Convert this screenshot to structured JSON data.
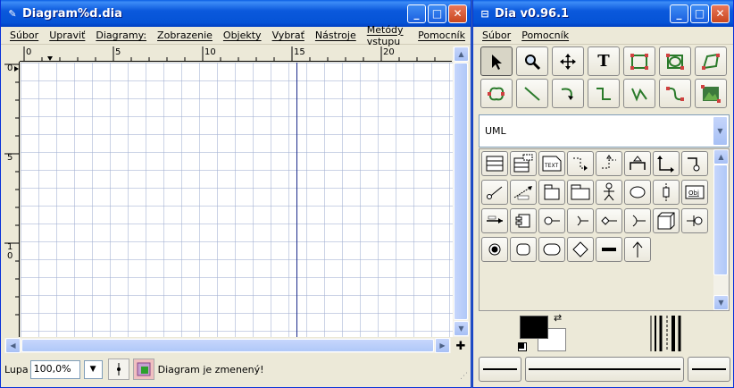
{
  "main_window": {
    "title": "Diagram%d.dia",
    "menu": [
      "Súbor",
      "Upraviť",
      "Diagramy:",
      "Zobrazenie",
      "Objekty",
      "Vybrať",
      "Nástroje",
      "Metódy vstupu",
      "Pomocník"
    ],
    "ruler_h": [
      "0",
      "5",
      "10",
      "15",
      "20"
    ],
    "ruler_v": [
      "0",
      "5",
      "1",
      "0"
    ],
    "zoom_label": "Lupa",
    "zoom_value": "100,0%",
    "status": "Diagram je zmenený!"
  },
  "toolbox": {
    "title": "Dia v0.96.1",
    "menu": [
      "Súbor",
      "Pomocník"
    ],
    "sheet": "UML",
    "tools": [
      "modify-tool",
      "zoom-tool",
      "scroll-tool",
      "text-tool",
      "box-tool",
      "ellipse-tool",
      "polygon-tool",
      "beziergon-tool",
      "line-tool",
      "arc-tool",
      "zigzagline-tool",
      "polyline-tool",
      "bezierline-tool",
      "image-tool"
    ],
    "uml_shapes": [
      "class",
      "template-class",
      "note",
      "dependency",
      "realization",
      "generalization",
      "association",
      "implements",
      "constraint",
      "small-package",
      "large-package",
      "actor",
      "use-case",
      "lifeline",
      "object",
      "message",
      "component",
      "fork-join",
      "initial",
      "branch",
      "node",
      "interface-a",
      "state",
      "activity",
      "decision",
      "state-term",
      "arrow"
    ],
    "text_labels": {
      "note": "TEXT",
      "object": "Obj"
    },
    "fg_color": "#000000",
    "bg_color": "#ffffff"
  }
}
